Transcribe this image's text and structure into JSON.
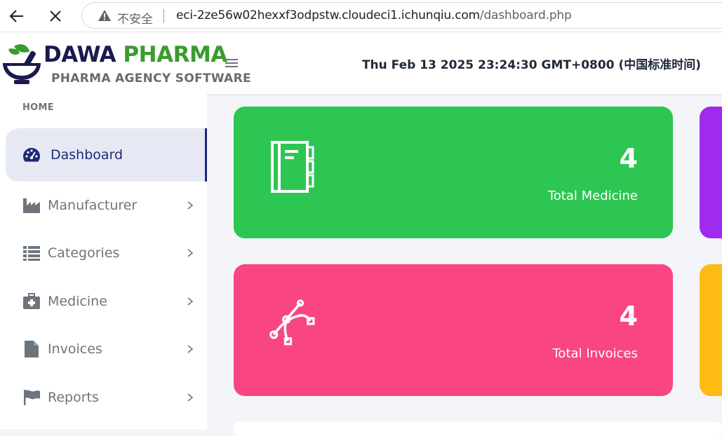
{
  "browser": {
    "security_label": "不安全",
    "url_host": "eci-2ze56w02hexxf3odpstw.cloudeci1.ichunqiu.com",
    "url_path": "/dashboard.php"
  },
  "header": {
    "logo_word1": "DAWA",
    "logo_word2": "PHARMA",
    "logo_subtitle": "PHARMA AGENCY SOFTWARE",
    "datetime": "Thu Feb 13 2025 23:24:30 GMT+0800 (中国标准时间)"
  },
  "sidebar": {
    "section_label": "HOME",
    "items": [
      {
        "label": "Dashboard",
        "icon": "dashboard-gauge-icon"
      },
      {
        "label": "Manufacturer",
        "icon": "industry-icon"
      },
      {
        "label": "Categories",
        "icon": "list-icon"
      },
      {
        "label": "Medicine",
        "icon": "medkit-icon"
      },
      {
        "label": "Invoices",
        "icon": "file-icon"
      },
      {
        "label": "Reports",
        "icon": "flag-icon"
      }
    ]
  },
  "cards": {
    "medicine": {
      "count": "4",
      "label": "Total Medicine",
      "color": "#2dc653"
    },
    "invoices": {
      "count": "4",
      "label": "Total Invoices",
      "color": "#f94683"
    },
    "third_color": "#a02bf0",
    "fourth_color": "#fdbb13"
  },
  "colors": {
    "accent": "#1e2a78",
    "brand_green": "#3a9b2e"
  }
}
